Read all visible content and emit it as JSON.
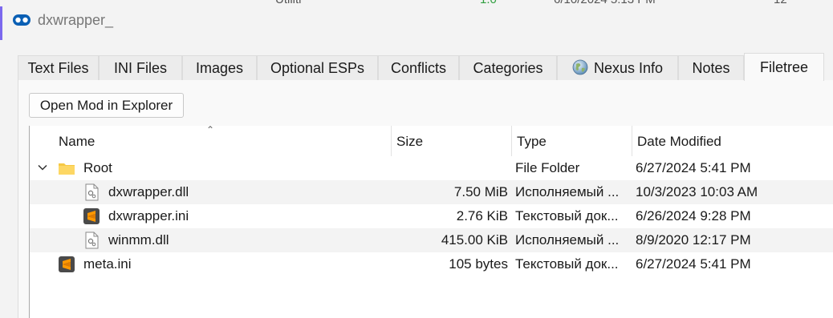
{
  "window": {
    "title": "dxwrapper_"
  },
  "tabs": [
    {
      "label": "Text Files"
    },
    {
      "label": "INI Files"
    },
    {
      "label": "Images"
    },
    {
      "label": "Optional ESPs"
    },
    {
      "label": "Conflicts"
    },
    {
      "label": "Categories"
    },
    {
      "label": "Nexus Info",
      "icon": "globe-icon"
    },
    {
      "label": "Notes"
    },
    {
      "label": "Filetree",
      "active": true
    }
  ],
  "toolbar": {
    "open_mod_label": "Open Mod in Explorer"
  },
  "tree": {
    "sorted_column": "Name",
    "columns": {
      "name": "Name",
      "size": "Size",
      "type": "Type",
      "date": "Date Modified"
    },
    "rows": [
      {
        "name": "Root",
        "size": "",
        "type": "File Folder",
        "date": "6/27/2024 5:41 PM",
        "icon": "folder-icon",
        "expanded": true,
        "level": 0
      },
      {
        "name": "dxwrapper.dll",
        "size": "7.50 MiB",
        "type": "Исполняемый ...",
        "date": "10/3/2023 10:03 AM",
        "icon": "dll-file-icon",
        "level": 1
      },
      {
        "name": "dxwrapper.ini",
        "size": "2.76 KiB",
        "type": "Текстовый док...",
        "date": "6/26/2024 9:28 PM",
        "icon": "sublime-text-icon",
        "level": 1
      },
      {
        "name": "winmm.dll",
        "size": "415.00 KiB",
        "type": "Исполняемый ...",
        "date": "8/9/2020 12:17 PM",
        "icon": "dll-file-icon",
        "level": 1
      },
      {
        "name": "meta.ini",
        "size": "105 bytes",
        "type": "Текстовый док...",
        "date": "6/27/2024 5:41 PM",
        "icon": "sublime-text-icon",
        "level": 0
      }
    ]
  },
  "colors": {
    "accent": "#7b68ee",
    "folder": "#f6c945",
    "sublime": "#ff9800",
    "title_icon": "#0a5fb4"
  }
}
